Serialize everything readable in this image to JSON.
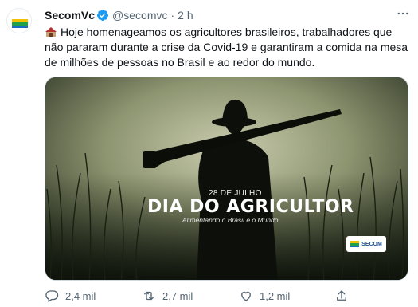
{
  "tweet": {
    "author_name": "SecomVc",
    "author_handle": "@secomvc",
    "separator": "·",
    "time": "2 h",
    "text": "Hoje homenageamos os agricultores brasileiros, trabalhadores que não pararam durante a crise da Covid-19 e garantiram a comida na mesa de milhões de pessoas no Brasil e ao redor do mundo.",
    "emoji_icon": "farmer-emoji",
    "media": {
      "date": "28 DE JULHO",
      "title": "DIA DO AGRICULTOR",
      "subtitle": "Alimentando o Brasil e o Mundo",
      "logo_text": "SECOM"
    },
    "actions": {
      "replies": "2,4 mil",
      "retweets": "2,7 mil",
      "likes": "1,2 mil"
    }
  },
  "colors": {
    "text_primary": "#0f1419",
    "text_secondary": "#536471",
    "verified": "#1d9bf0",
    "border": "#cfd9de"
  }
}
